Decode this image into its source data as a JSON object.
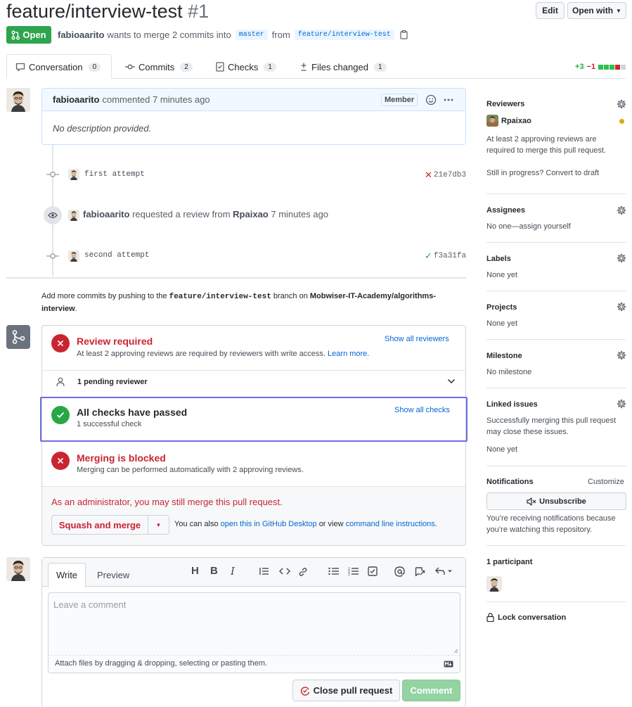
{
  "header": {
    "title": "feature/interview-test",
    "number": "#1",
    "edit_label": "Edit",
    "open_with_label": "Open with",
    "status_label": "Open",
    "author": "fabioaarito",
    "merge_text": "wants to merge 2 commits into",
    "base_branch": "master",
    "from_text": "from",
    "head_branch": "feature/interview-test"
  },
  "tabs": [
    {
      "label": "Conversation",
      "count": "0"
    },
    {
      "label": "Commits",
      "count": "2"
    },
    {
      "label": "Checks",
      "count": "1"
    },
    {
      "label": "Files changed",
      "count": "1"
    }
  ],
  "diffstat": {
    "added": "+3",
    "removed": "−1"
  },
  "comment": {
    "author": "fabioaarito",
    "action": "commented 7 minutes ago",
    "badge": "Member",
    "body": "No description provided."
  },
  "timeline": {
    "commit1": {
      "message": "first attempt",
      "sha": "21e7db3",
      "status": "fail"
    },
    "review_request": {
      "actor": "fabioaarito",
      "text": "requested a review from",
      "reviewer": "Rpaixao",
      "time": "7 minutes ago"
    },
    "commit2": {
      "message": "second attempt",
      "sha": "f3a31fa",
      "status": "pass"
    }
  },
  "push_note": {
    "prefix": "Add more commits by pushing to the",
    "branch": "feature/interview-test",
    "middle": "branch on",
    "repo": "Mobwiser-IT-Academy/algorithms-interview",
    "suffix": "."
  },
  "merge_box": {
    "review_title": "Review required",
    "review_desc": "At least 2 approving reviews are required by reviewers with write access.",
    "learn_more": "Learn more.",
    "show_reviewers": "Show all reviewers",
    "pending": "1 pending reviewer",
    "checks_title": "All checks have passed",
    "checks_desc": "1 successful check",
    "show_checks": "Show all checks",
    "blocked_title": "Merging is blocked",
    "blocked_desc": "Merging can be performed automatically with 2 approving reviews.",
    "admin_note": "As an administrator, you may still merge this pull request.",
    "merge_button": "Squash and merge",
    "also_text": "You can also",
    "desktop_link": "open this in GitHub Desktop",
    "or_view": "or view",
    "cli_link": "command line instructions",
    "end": "."
  },
  "composer": {
    "tab_write": "Write",
    "tab_preview": "Preview",
    "placeholder": "Leave a comment",
    "attach_text": "Attach files by dragging & dropping, selecting or pasting them.",
    "close_label": "Close pull request",
    "comment_label": "Comment"
  },
  "sidebar": {
    "reviewers_title": "Reviewers",
    "reviewer_name": "Rpaixao",
    "reviewers_note": "At least 2 approving reviews are required to merge this pull request.",
    "draft_note": "Still in progress? Convert to draft",
    "assignees_title": "Assignees",
    "assignees_value": "No one—assign yourself",
    "labels_title": "Labels",
    "labels_value": "None yet",
    "projects_title": "Projects",
    "projects_value": "None yet",
    "milestone_title": "Milestone",
    "milestone_value": "No milestone",
    "linked_title": "Linked issues",
    "linked_desc": "Successfully merging this pull request may close these issues.",
    "linked_value": "None yet",
    "notifications_title": "Notifications",
    "customize": "Customize",
    "unsubscribe": "Unsubscribe",
    "notif_note": "You’re receiving notifications because you’re watching this repository.",
    "participants": "1 participant",
    "lock": "Lock conversation"
  },
  "colors": {
    "accent": "#0366d6",
    "success": "#28a745",
    "danger": "#cb2431",
    "highlight": "#6f6ce0"
  }
}
